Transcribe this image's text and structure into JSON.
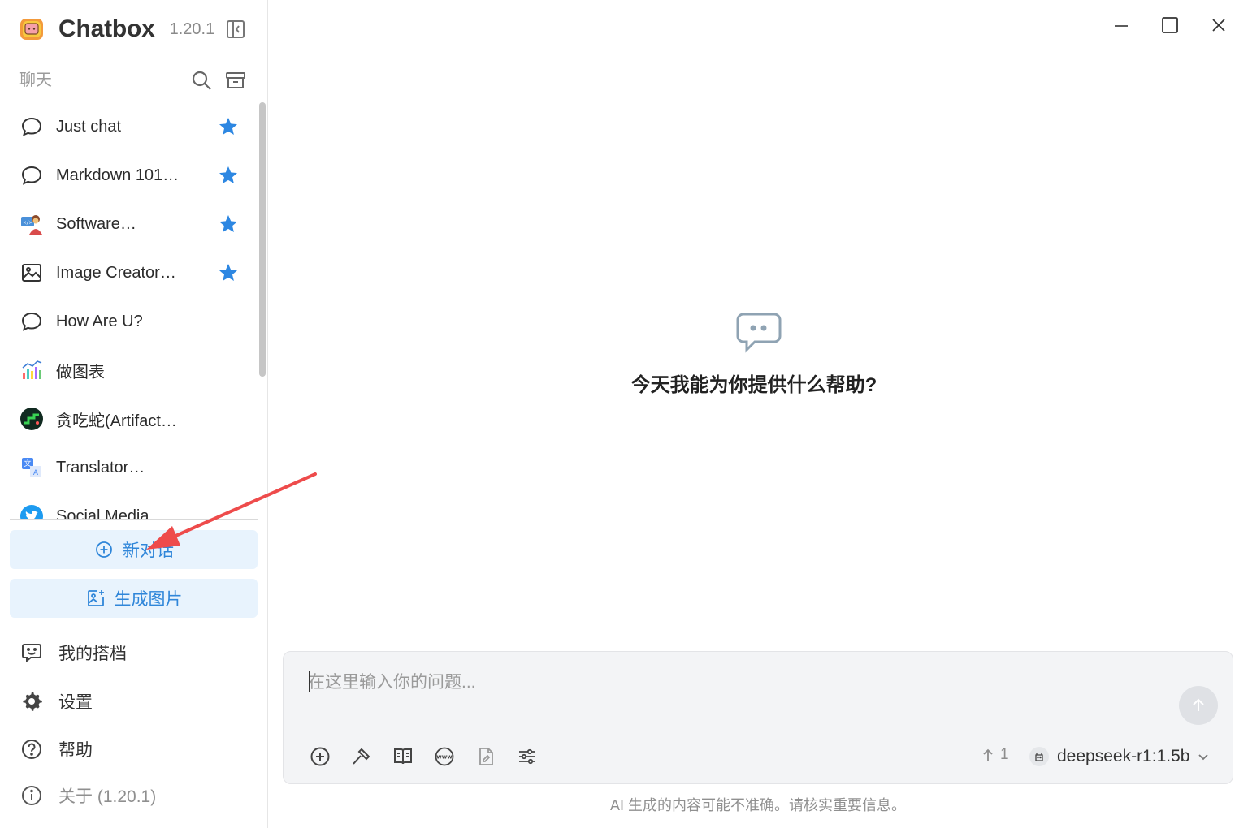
{
  "app": {
    "name": "Chatbox",
    "version": "1.20.1"
  },
  "sidebar": {
    "section_title": "聊天",
    "sessions": [
      {
        "label": "Just chat",
        "icon": "chat-bubble-icon",
        "starred": true
      },
      {
        "label": "Markdown 101…",
        "icon": "chat-bubble-icon",
        "starred": true
      },
      {
        "label": "Software…",
        "icon": "developer-avatar-icon",
        "starred": true
      },
      {
        "label": "Image Creator…",
        "icon": "image-icon",
        "starred": true
      },
      {
        "label": "How Are U?",
        "icon": "chat-bubble-icon",
        "starred": false
      },
      {
        "label": "做图表",
        "icon": "chart-avatar-icon",
        "starred": false
      },
      {
        "label": "贪吃蛇(Artifact…",
        "icon": "snake-game-avatar-icon",
        "starred": false
      },
      {
        "label": "Translator…",
        "icon": "translate-avatar-icon",
        "starred": false
      },
      {
        "label": "Social Media…",
        "icon": "bird-avatar-icon",
        "starred": false
      }
    ],
    "new_chat_label": "新对话",
    "generate_image_label": "生成图片",
    "nav": {
      "copilots": "我的搭档",
      "settings": "设置",
      "help": "帮助",
      "about": "关于 (1.20.1)"
    }
  },
  "main": {
    "empty_title": "今天我能为你提供什么帮助?"
  },
  "composer": {
    "placeholder": "在这里输入你的问题...",
    "value": "",
    "context_count": "1",
    "model": "deepseek-r1:1.5b",
    "tools": [
      "add-attachment-icon",
      "hammer-icon",
      "knowledge-book-icon",
      "web-search-icon",
      "file-icon",
      "settings-sliders-icon"
    ]
  },
  "footer": {
    "disclaimer": "AI 生成的内容可能不准确。请核实重要信息。"
  },
  "colors": {
    "accent": "#2f86d9",
    "star": "#2d87e2",
    "button_bg": "#e8f3fd",
    "annotation_arrow": "#ee4b4b"
  }
}
